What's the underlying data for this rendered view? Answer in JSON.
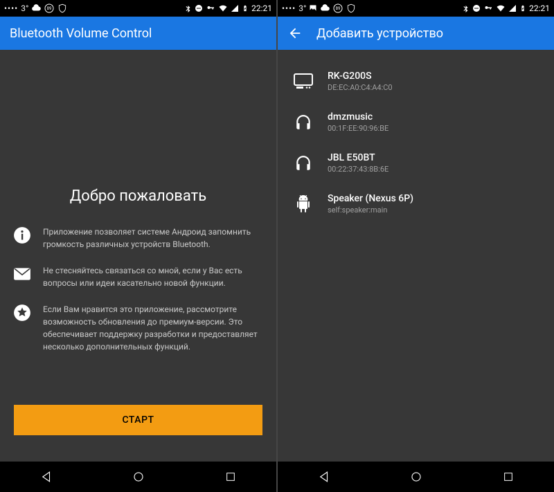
{
  "status": {
    "dots": "••••",
    "temp": "3°",
    "battery": "89",
    "time": "22:21"
  },
  "screen1": {
    "title": "Bluetooth Volume Control",
    "welcome": "Добро пожаловать",
    "info1": "Приложение позволяет системе Андроид запомнить громкость различных устройств Bluetooth.",
    "info2": "Не стесняйтесь связаться со мной, если у Вас есть вопросы или идеи касательно новой функции.",
    "info3": "Если Вам нравится это приложение, рассмотрите возможность обновления до премиум-версии. Это обеспечивает поддержку разработки и предоставляет несколько дополнительных функций.",
    "start": "СТАРТ"
  },
  "screen2": {
    "title": "Добавить устройство",
    "devices": [
      {
        "name": "RK-G200S",
        "mac": "DE:EC:A0:C4:A4:C0",
        "icon": "tv"
      },
      {
        "name": "dmzmusic",
        "mac": "00:1F:EE:90:96:BE",
        "icon": "headphones"
      },
      {
        "name": "JBL E50BT",
        "mac": "00:22:37:43:8B:6E",
        "icon": "headphones"
      },
      {
        "name": "Speaker (Nexus 6P)",
        "mac": "self:speaker:main",
        "icon": "android"
      }
    ]
  }
}
